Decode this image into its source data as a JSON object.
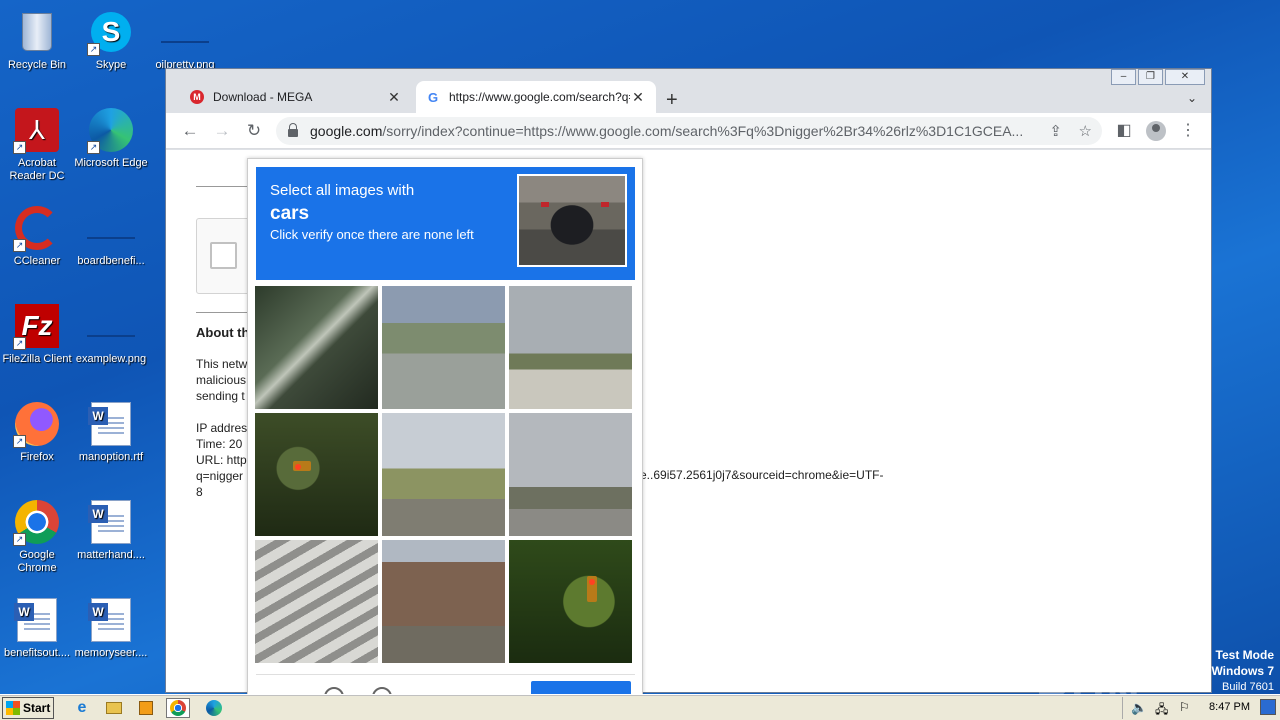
{
  "desktop": {
    "icons": [
      {
        "label": "Recycle Bin"
      },
      {
        "label": "Skype"
      },
      {
        "label": "oilpretty.png"
      },
      {
        "label": "Acrobat Reader DC"
      },
      {
        "label": "Microsoft Edge"
      },
      {
        "label": "CCleaner"
      },
      {
        "label": "boardbenefi..."
      },
      {
        "label": "FileZilla Client"
      },
      {
        "label": "examplew.png"
      },
      {
        "label": "Firefox"
      },
      {
        "label": "manoption.rtf"
      },
      {
        "label": "Google Chrome"
      },
      {
        "label": "matterhand...."
      },
      {
        "label": "benefitsout...."
      },
      {
        "label": "memoryseer...."
      }
    ]
  },
  "browser": {
    "tabs": [
      {
        "title": "Download - MEGA",
        "favicon_color": "#d9272e",
        "favicon_letter": "M"
      },
      {
        "title": "https://www.google.com/search?q=",
        "favicon_letter": "G"
      }
    ],
    "address": {
      "host": "google.com",
      "path": "/sorry/index?continue=https://www.google.com/search%3Fq%3Dnigger%2Br34%26rlz%3D1C1GCEA..."
    },
    "window_buttons": {
      "minimize": "–",
      "restore": "❐",
      "close": "✕"
    }
  },
  "page": {
    "about_title": "About th",
    "para_lines": [
      "This netw",
      "malicious",
      "sending t"
    ],
    "info_lines": [
      "IP addres",
      "Time: 20",
      "URL: http",
      "q=nigger",
      "8"
    ],
    "url_tail": "e..69i57.2561j0j7&sourceid=chrome&ie=UTF-"
  },
  "captcha": {
    "line1": "Select all images with",
    "target": "cars",
    "line3": "Click verify once there are none left"
  },
  "watermark": "ANY ▷ RUN",
  "test_mode": {
    "line1": "Test Mode",
    "line2": "Windows 7",
    "line3": "Build 7601"
  },
  "taskbar": {
    "start_label": "Start",
    "clock": "8:47 PM"
  }
}
